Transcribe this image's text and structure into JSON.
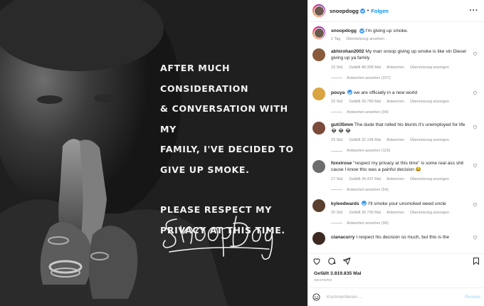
{
  "post": {
    "username": "snoopdogg",
    "follow_label": "Folgen",
    "caption": "I'm giving up smoke.",
    "caption_time": "1 Tag",
    "caption_translate": "Übersetzung ansehen",
    "likes": "Gefällt 3.819.835 Mal",
    "date": "GESTERN",
    "comment_placeholder": "Kommentieren ...",
    "post_button": "Posten"
  },
  "image_text": {
    "line1": "AFTER MUCH CONSIDERATION",
    "line2": "& CONVERSATION WITH MY",
    "line3": "FAMILY, I'VE DECIDED TO",
    "line4": "GIVE UP SMOKE.",
    "line5": "PLEASE RESPECT MY",
    "line6": "PRIVACY AT THIS TIME.",
    "signature": "Snoop Dogg"
  },
  "comments": [
    {
      "username": "abhirohan2002",
      "text": "My man snoop giving up smoke is like vin Diesel giving up ya family",
      "time": "23 Std.",
      "likes": "Gefällt 48.358 Mal",
      "reply": "Antworten",
      "translate": "Übersetzung anzeigen",
      "view_replies": "Antworten ansehen (227)",
      "avatar_color": "#8a5a3c"
    },
    {
      "username": "pouya",
      "text": "we are officially in a new world",
      "time": "23 Std.",
      "likes": "Gefällt 39.780 Mal",
      "reply": "Antworten",
      "translate": "Übersetzung anzeigen",
      "view_replies": "Antworten ansehen (94)",
      "avatar_color": "#d9a441"
    },
    {
      "username": "guti35mm",
      "text": "The dude that rolled his blunts it's unemployed for life 👽 👽 👽",
      "time": "23 Std.",
      "likes": "Gefällt 32.194 Mal",
      "reply": "Antworten",
      "translate": "Übersetzung anzeigen",
      "view_replies": "Antworten ansehen (119)",
      "avatar_color": "#7a4a3a"
    },
    {
      "username": "foxxirose",
      "text": "\"respect my privacy at this time\" is some real ass shit cause I know this was a painful decision 😂",
      "time": "17 Std.",
      "likes": "Gefällt 34.437 Mal",
      "reply": "Antworten",
      "translate": "Übersetzung anzeigen",
      "view_replies": "Antworten ansehen (54)",
      "avatar_color": "#6d6d6d"
    },
    {
      "username": "kyleedwards",
      "text": "I'll smoke your unsmoked weed uncle",
      "time": "20 Std.",
      "likes": "Gefällt 30.730 Mal",
      "reply": "Antworten",
      "translate": "Übersetzung anzeigen",
      "view_replies": "Antworten ansehen (90)",
      "avatar_color": "#5a3f2e"
    },
    {
      "username": "cianacurry",
      "text": "I respect his decision so much, but this is the",
      "avatar_color": "#3c2a22"
    }
  ],
  "icons": {
    "more": "more-options-icon",
    "like": "heart-icon",
    "comment": "comment-icon",
    "share": "share-icon",
    "save": "bookmark-icon",
    "emoji": "emoji-icon",
    "verified": "verified-badge-icon"
  },
  "colors": {
    "accent": "#0095f6",
    "verified": "#3897f0",
    "muted": "#8e8e8e"
  }
}
